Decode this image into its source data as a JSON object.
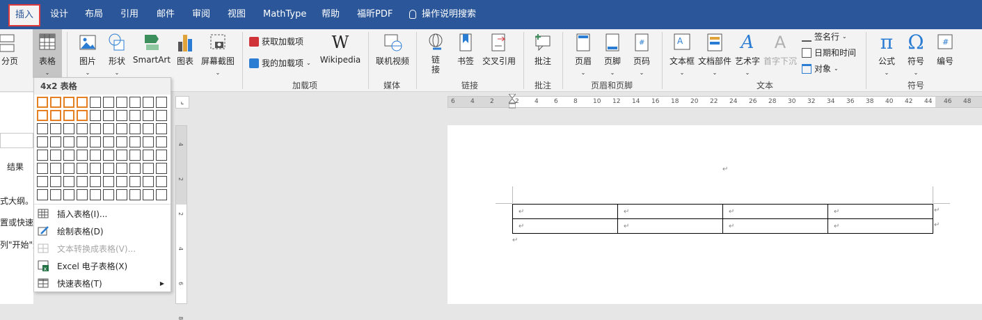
{
  "tabs": [
    {
      "label": "插入",
      "active": true
    },
    {
      "label": "设计"
    },
    {
      "label": "布局"
    },
    {
      "label": "引用"
    },
    {
      "label": "邮件"
    },
    {
      "label": "审阅"
    },
    {
      "label": "视图"
    },
    {
      "label": "MathType"
    },
    {
      "label": "帮助"
    },
    {
      "label": "福昕PDF"
    }
  ],
  "search_label": "操作说明搜索",
  "ribbon": {
    "fenye": "分页",
    "table": "表格",
    "picture": "图片",
    "shape": "形状",
    "smartart": "SmartArt",
    "chart": "图表",
    "screenshot": "屏幕截图",
    "get_addins": "获取加载项",
    "my_addins": "我的加载项",
    "wikipedia": "Wikipedia",
    "online_video": "联机视频",
    "link": "链接",
    "bookmark": "书签",
    "crossref": "交叉引用",
    "comment": "批注",
    "header": "页眉",
    "footer": "页脚",
    "pagenum": "页码",
    "textbox": "文本框",
    "quickparts": "文档部件",
    "wordart": "艺术字",
    "dropcap": "首字下沉",
    "signature": "签名行",
    "datetime": "日期和时间",
    "object": "对象",
    "equation": "公式",
    "symbol": "符号",
    "number": "编号",
    "groups": {
      "addins": "加载项",
      "media": "媒体",
      "links": "链接",
      "comments": "批注",
      "headerfooter": "页眉和页脚",
      "text": "文本",
      "symbols": "符号"
    }
  },
  "navpane": {
    "result": "结果",
    "line1": "式大纲。",
    "line2": "置或快速稍",
    "line3": "列\"开始\"选"
  },
  "dropdown": {
    "header": "4x2 表格",
    "selected_cols": 4,
    "selected_rows": 2,
    "items": [
      {
        "label": "插入表格(I)...",
        "disabled": false
      },
      {
        "label": "绘制表格(D)",
        "disabled": false
      },
      {
        "label": "文本转换成表格(V)...",
        "disabled": true
      },
      {
        "label": "Excel 电子表格(X)",
        "disabled": false
      },
      {
        "label": "快速表格(T)",
        "disabled": false
      }
    ]
  },
  "ruler": {
    "numbers": [
      "6",
      "4",
      "2",
      "2",
      "4",
      "6",
      "8",
      "10",
      "12",
      "14",
      "16",
      "18",
      "20",
      "22",
      "24",
      "26",
      "28",
      "30",
      "32",
      "34",
      "36",
      "38",
      "40",
      "42",
      "44",
      "46",
      "48"
    ]
  },
  "vruler": {
    "numbers": [
      "4",
      "2",
      "2",
      "4",
      "6",
      "8"
    ]
  },
  "colors": {
    "accent": "#2b579a",
    "highlight": "#e67e22",
    "active_border": "#e03a3a"
  }
}
